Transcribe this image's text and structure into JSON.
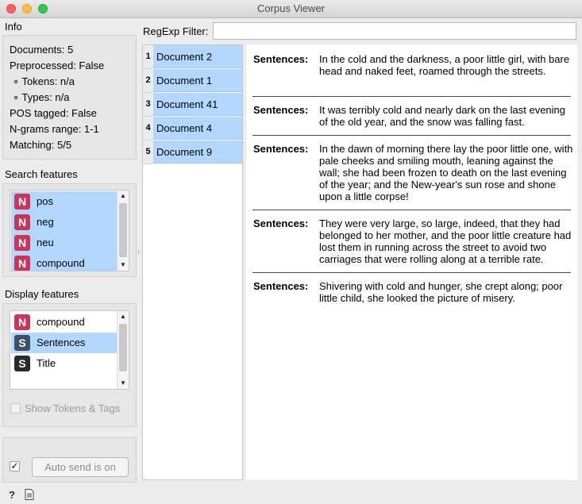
{
  "window": {
    "title": "Corpus Viewer"
  },
  "info": {
    "label": "Info",
    "lines": [
      "Documents: 5",
      "Preprocessed: False",
      "∘ Tokens: n/a",
      "∘ Types: n/a",
      "POS tagged: False",
      "N-grams range: 1-1",
      "Matching: 5/5"
    ]
  },
  "search_features": {
    "label": "Search features",
    "items": [
      {
        "icon": "N",
        "label": "pos"
      },
      {
        "icon": "N",
        "label": "neg"
      },
      {
        "icon": "N",
        "label": "neu"
      },
      {
        "icon": "N",
        "label": "compound"
      }
    ]
  },
  "display_features": {
    "label": "Display features",
    "items": [
      {
        "icon": "N",
        "label": "compound"
      },
      {
        "icon": "S",
        "label": "Sentences"
      },
      {
        "icon": "S",
        "label": "Title"
      }
    ],
    "show_tokens_label": "Show Tokens & Tags"
  },
  "auto_send": {
    "label": "Auto send is on",
    "checked_mark": "✓"
  },
  "filter": {
    "label": "RegExp Filter:",
    "value": ""
  },
  "documents": [
    {
      "num": "1",
      "name": "Document 2"
    },
    {
      "num": "2",
      "name": "Document 1"
    },
    {
      "num": "3",
      "name": "Document 41"
    },
    {
      "num": "4",
      "name": "Document 4"
    },
    {
      "num": "5",
      "name": "Document 9"
    }
  ],
  "content": {
    "field_label": "Sentences:",
    "entries": [
      "In the cold and the darkness, a poor little girl, with bare head and naked feet, roamed through the streets.",
      "It was terribly cold and nearly dark on the last evening of the old year, and the snow was falling fast.",
      "In the dawn of morning there lay the poor little one, with pale cheeks and smiling mouth, leaning against the wall; she had been frozen to death on the last evening of the year; and the New-year's sun rose and shone upon a little corpse!",
      "They were very large, so large, indeed, that they had belonged to her mother, and the poor little creature had lost them in running across the street to avoid two carriages that were rolling along at a terrible rate.",
      "Shivering with cold and hunger, she crept along; poor little child, she looked the picture of misery."
    ]
  },
  "colors": {
    "selection": "#b3d7ff",
    "numeric_badge": "#c8375a",
    "string_badge": "#2b2b2b"
  }
}
